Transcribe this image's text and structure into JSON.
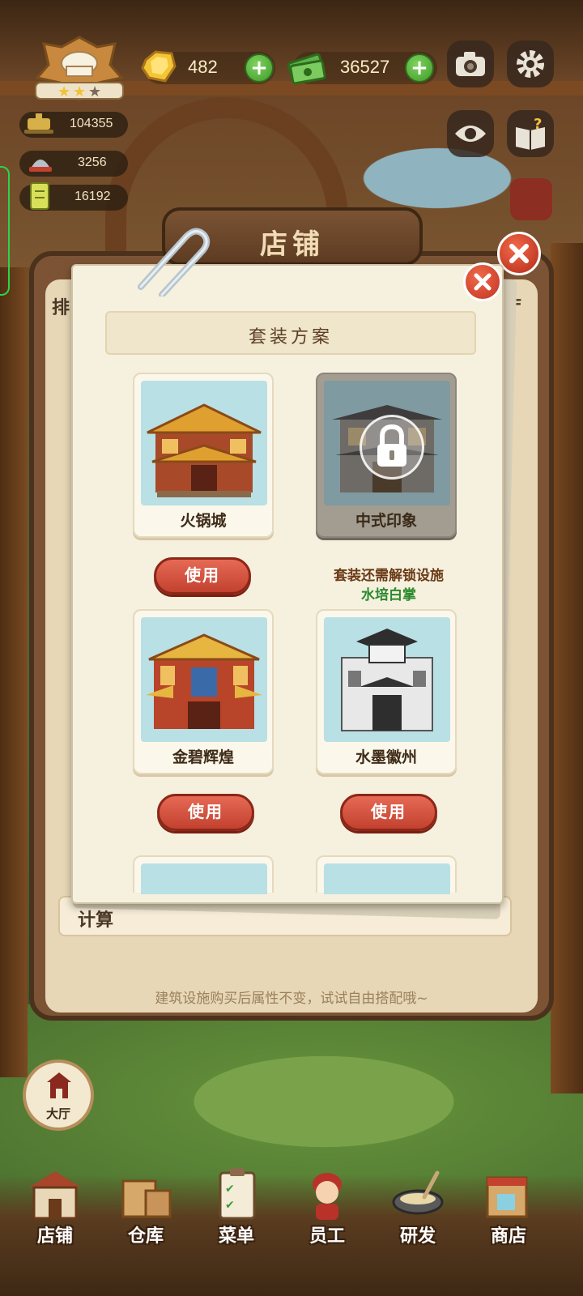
{
  "hud": {
    "gems": "482",
    "cash": "36527",
    "stats": [
      {
        "icon": "hotpot-icon",
        "value": "104355"
      },
      {
        "icon": "chef-helmet-icon",
        "value": "3256"
      },
      {
        "icon": "ticket-icon",
        "value": "16192"
      }
    ],
    "colors": {
      "plus": "#3f9a2a",
      "accent_red": "#c2412f"
    }
  },
  "back_panel": {
    "title": "店铺",
    "left_fragment": "排",
    "right_fragment": "厅",
    "row_fragment": "计算",
    "footer": "建筑设施购买后属性不变，试试自由搭配哦~"
  },
  "dialog": {
    "title": "套装方案",
    "cards": [
      {
        "name": "火锅城",
        "state": "available",
        "button": "使用"
      },
      {
        "name": "中式印象",
        "state": "locked",
        "note": "套装还需解锁设施",
        "required_item": "水培白掌"
      },
      {
        "name": "金碧辉煌",
        "state": "available",
        "button": "使用"
      },
      {
        "name": "水墨徽州",
        "state": "available",
        "button": "使用"
      }
    ]
  },
  "hall_button": "大厅",
  "nav": [
    {
      "label": "店铺",
      "icon": "shop-building-icon"
    },
    {
      "label": "仓库",
      "icon": "crate-icon"
    },
    {
      "label": "菜单",
      "icon": "clipboard-icon"
    },
    {
      "label": "员工",
      "icon": "staff-girl-icon"
    },
    {
      "label": "研发",
      "icon": "wok-icon"
    },
    {
      "label": "商店",
      "icon": "store-icon"
    }
  ]
}
